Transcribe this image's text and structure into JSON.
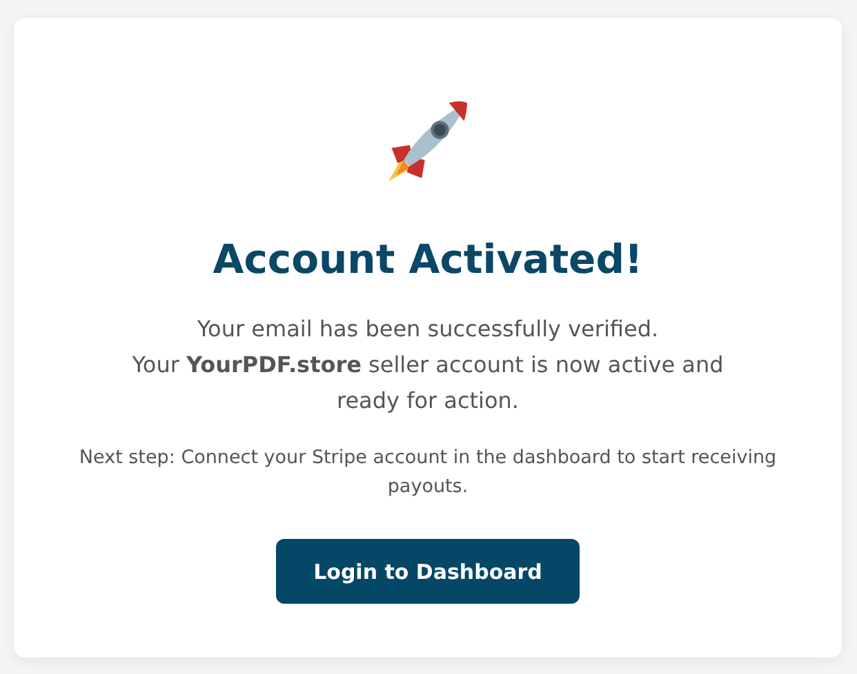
{
  "card": {
    "title": "Account Activated!",
    "message": [
      "Your email has been successfully verified.",
      "Your **YourPDF.store** seller account is now active and ready for action."
    ],
    "note": "Next step: Connect your Stripe account in the dashboard to start receiving payouts.",
    "button": {
      "label": "Login to Dashboard"
    }
  }
}
